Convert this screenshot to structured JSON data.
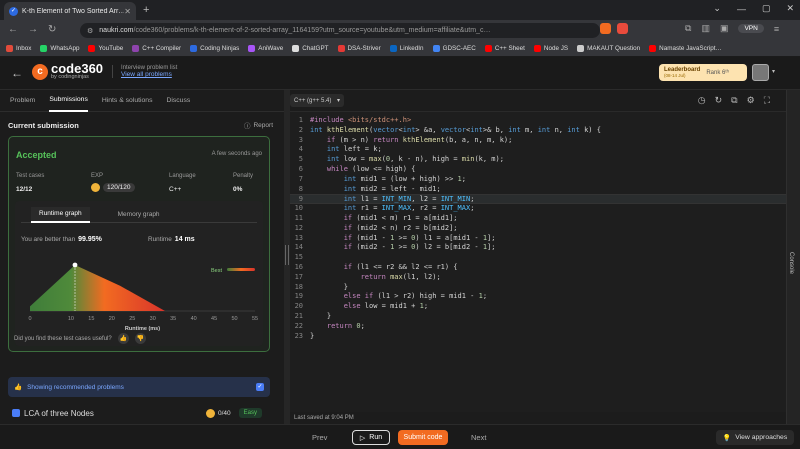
{
  "browser": {
    "tab_title": "K-th Element of Two Sorted Arr…",
    "url_main": "naukri.com",
    "url_rest": "/code360/problems/k-th-element-of-2-sorted-array_1164159?utm_source=youtube&utm_medium=affiliate&utm_c…",
    "vpn_label": "VPN"
  },
  "bookmarks": [
    {
      "label": "Inbox",
      "color": "#e24b3b"
    },
    {
      "label": "WhatsApp",
      "color": "#25d366"
    },
    {
      "label": "YouTube",
      "color": "#ff0000"
    },
    {
      "label": "C++ Compiler",
      "color": "#8e44ad"
    },
    {
      "label": "Coding Ninjas",
      "color": "#2d6ae0"
    },
    {
      "label": "AniWave",
      "color": "#a855f7"
    },
    {
      "label": "ChatGPT",
      "color": "#dddddd"
    },
    {
      "label": "DSA-Striver",
      "color": "#e53935"
    },
    {
      "label": "LinkedIn",
      "color": "#0a66c2"
    },
    {
      "label": "GDSC-AEC",
      "color": "#4285f4"
    },
    {
      "label": "C++ Sheet",
      "color": "#ff0000"
    },
    {
      "label": "Node JS",
      "color": "#ff0000"
    },
    {
      "label": "MAKAUT Question",
      "color": "#cccccc"
    },
    {
      "label": "Namaste JavaScript…",
      "color": "#ff0000"
    }
  ],
  "site": {
    "logo_main": "code360",
    "logo_sub": "by codingninjas",
    "ipl_title": "Interview problem list",
    "ipl_link": "View all problems",
    "leaderboard": "Leaderboard",
    "leaderboard_dates": "(08-14 Jul)",
    "rank": "Rank 6ᵗʰ"
  },
  "left_tabs": [
    "Problem",
    "Submissions",
    "Hints & solutions",
    "Discuss"
  ],
  "submission": {
    "header": "Current submission",
    "report": "Report",
    "status": "Accepted",
    "time_ago": "A few seconds ago",
    "stats": [
      {
        "label": "Test cases",
        "value": "12/12"
      },
      {
        "label": "EXP",
        "value": "120/120"
      },
      {
        "label": "Language",
        "value": "C++"
      },
      {
        "label": "Penalty",
        "value": "0%"
      }
    ],
    "graph_tabs": [
      "Runtime graph",
      "Memory graph"
    ],
    "better_label": "You are better than",
    "better_value": "99.95%",
    "runtime_label": "Runtime",
    "runtime_value": "14 ms",
    "useful_q": "Did you find these test cases useful?"
  },
  "chart_data": {
    "type": "area",
    "x": [
      0,
      11,
      22,
      33
    ],
    "y": [
      10,
      100,
      55,
      0
    ],
    "xticks": [
      0,
      10,
      15,
      20,
      25,
      30,
      35,
      40,
      45,
      50,
      55
    ],
    "xlabel": "Runtime (ms)",
    "highlight_x": 11,
    "legend": "Best",
    "colors": {
      "green": "#3f7d3a",
      "orange": "#f26b21",
      "red": "#d9342b"
    }
  },
  "recommend": {
    "label": "Showing recommended problems"
  },
  "next_problem": {
    "name": "LCA of three Nodes",
    "points": "0/40",
    "difficulty": "Easy"
  },
  "editor": {
    "language": "C++ (g++ 5.4)",
    "current_line": 9,
    "lines": [
      "#include <bits/stdc++.h>",
      "int kthElement(vector<int> &a, vector<int>& b, int m, int n, int k) {",
      "    if (m > n) return kthElement(b, a, n, m, k);",
      "    int left = k;",
      "    int low = max(0, k - n), high = min(k, m);",
      "    while (low <= high) {",
      "        int mid1 = (low + high) >> 1;",
      "        int mid2 = left - mid1;",
      "        int l1 = INT_MIN, l2 = INT_MIN;",
      "        int r1 = INT_MAX, r2 = INT_MAX;",
      "        if (mid1 < m) r1 = a[mid1];",
      "        if (mid2 < n) r2 = b[mid2];",
      "        if (mid1 - 1 >= 0) l1 = a[mid1 - 1];",
      "        if (mid2 - 1 >= 0) l2 = b[mid2 - 1];",
      "",
      "        if (l1 <= r2 && l2 <= r1) {",
      "            return max(l1, l2);",
      "        }",
      "        else if (l1 > r2) high = mid1 - 1;",
      "        else low = mid1 + 1;",
      "    }",
      "    return 0;",
      "}"
    ],
    "saved": "Last saved at 9:04 PM",
    "console": "Console"
  },
  "bottom": {
    "prev": "Prev",
    "run": "Run",
    "submit": "Submit code",
    "next": "Next",
    "view": "View approaches"
  }
}
